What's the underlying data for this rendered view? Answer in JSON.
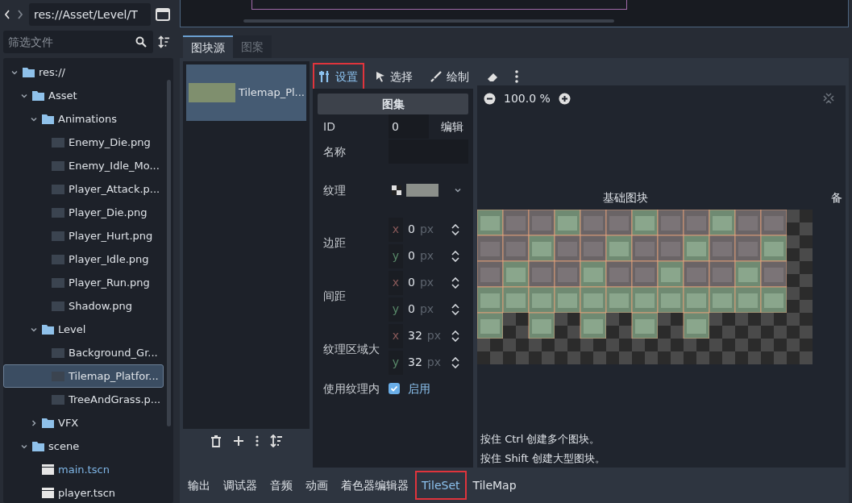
{
  "filesystem": {
    "path": "res://Asset/Level/T",
    "filter_placeholder": "筛选文件",
    "tree": [
      {
        "label": "res://",
        "kind": "folder",
        "expanded": true,
        "selected": false,
        "children": [
          {
            "label": "Asset",
            "kind": "folder",
            "expanded": true,
            "selected": false,
            "children": [
              {
                "label": "Animations",
                "kind": "folder",
                "expanded": true,
                "selected": false,
                "children": [
                  {
                    "label": "Enemy_Die.png",
                    "kind": "image",
                    "selected": false
                  },
                  {
                    "label": "Enemy_Idle_Mo...",
                    "kind": "image",
                    "selected": false
                  },
                  {
                    "label": "Player_Attack.p...",
                    "kind": "image",
                    "selected": false
                  },
                  {
                    "label": "Player_Die.png",
                    "kind": "image",
                    "selected": false
                  },
                  {
                    "label": "Player_Hurt.png",
                    "kind": "image",
                    "selected": false
                  },
                  {
                    "label": "Player_Idle.png",
                    "kind": "image",
                    "selected": false
                  },
                  {
                    "label": "Player_Run.png",
                    "kind": "image",
                    "selected": false
                  },
                  {
                    "label": "Shadow.png",
                    "kind": "image",
                    "selected": false
                  }
                ]
              },
              {
                "label": "Level",
                "kind": "folder",
                "expanded": true,
                "selected": false,
                "children": [
                  {
                    "label": "Background_Gr...",
                    "kind": "image",
                    "selected": false
                  },
                  {
                    "label": "Tilemap_Platfor...",
                    "kind": "image",
                    "selected": true
                  },
                  {
                    "label": "TreeAndGrass.p...",
                    "kind": "image",
                    "selected": false
                  }
                ]
              },
              {
                "label": "VFX",
                "kind": "folder",
                "expanded": false,
                "selected": false
              }
            ]
          },
          {
            "label": "scene",
            "kind": "folder",
            "expanded": true,
            "selected": false,
            "children": [
              {
                "label": "main.tscn",
                "kind": "scene",
                "selected": false,
                "open": true
              },
              {
                "label": "player.tscn",
                "kind": "scene",
                "selected": false,
                "open": false
              }
            ]
          }
        ]
      }
    ]
  },
  "panel_tabs": [
    {
      "label": "图块源",
      "selected": true
    },
    {
      "label": "图案",
      "selected": false
    }
  ],
  "sources": [
    {
      "label": "Tilemap_Pl...",
      "selected": true
    }
  ],
  "toolbar": [
    {
      "label": "设置",
      "kind": "settings",
      "selected": true,
      "highlighted": true
    },
    {
      "label": "选择",
      "kind": "select",
      "selected": false,
      "highlighted": false
    },
    {
      "label": "绘制",
      "kind": "paint",
      "selected": false,
      "highlighted": false
    }
  ],
  "inspector": {
    "title": "图集",
    "rows": [
      {
        "kind": "id",
        "label": "ID",
        "value": "0",
        "button": "编辑"
      },
      {
        "kind": "name",
        "label": "名称"
      },
      {
        "kind": "texture",
        "label": "纹理"
      },
      {
        "kind": "vector",
        "label": "边距",
        "fields": [
          {
            "axis": "x",
            "value": "0",
            "unit": "px"
          },
          {
            "axis": "y",
            "value": "0",
            "unit": "px"
          }
        ]
      },
      {
        "kind": "vector",
        "label": "间距",
        "fields": [
          {
            "axis": "x",
            "value": "0",
            "unit": "px"
          },
          {
            "axis": "y",
            "value": "0",
            "unit": "px"
          }
        ]
      },
      {
        "kind": "vector",
        "label": "纹理区域大",
        "fields": [
          {
            "axis": "x",
            "value": "32",
            "unit": "px"
          },
          {
            "axis": "y",
            "value": "32",
            "unit": "px"
          }
        ]
      },
      {
        "kind": "check",
        "label": "使用纹理内",
        "checked": true,
        "text": "启用"
      }
    ]
  },
  "atlas": {
    "zoom": "100.0 %",
    "section_label": "基础图块",
    "alt_label": "备",
    "hints": [
      "按住 Ctrl 创建多个图块。",
      "按住 Shift 创建大型图块。"
    ]
  },
  "bottom_tabs": [
    {
      "label": "输出",
      "selected": false,
      "highlighted": false
    },
    {
      "label": "调试器",
      "selected": false,
      "highlighted": false
    },
    {
      "label": "音频",
      "selected": false,
      "highlighted": false
    },
    {
      "label": "动画",
      "selected": false,
      "highlighted": false
    },
    {
      "label": "着色器编辑器",
      "selected": false,
      "highlighted": false
    },
    {
      "label": "TileSet",
      "selected": true,
      "highlighted": true
    },
    {
      "label": "TileMap",
      "selected": false,
      "highlighted": false
    }
  ]
}
